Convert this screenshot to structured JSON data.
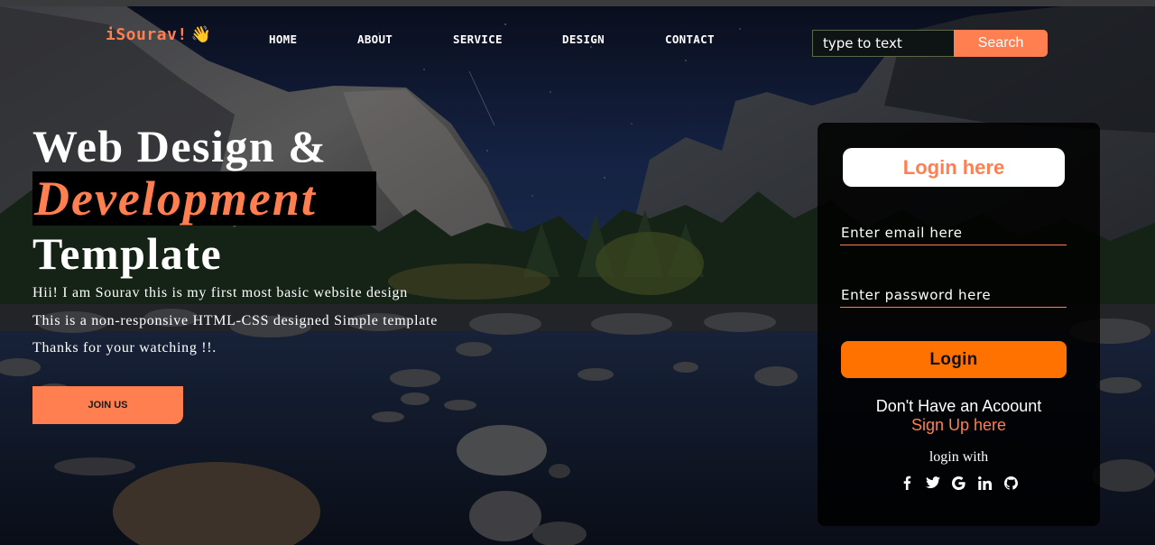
{
  "brand": {
    "name": "iSourav!",
    "emoji": "👋"
  },
  "nav": {
    "items": [
      "HOME",
      "ABOUT",
      "SERVICE",
      "DESIGN",
      "CONTACT"
    ]
  },
  "search": {
    "placeholder": "type to text",
    "button_label": "Search"
  },
  "hero": {
    "line1": "Web Design &",
    "line2": "Development",
    "line3": "Template",
    "paragraphs": [
      "Hii! I am Sourav this is my first most basic website design",
      "This is a non-responsive HTML-CSS designed Simple template",
      "Thanks for your watching !!."
    ],
    "cta_label": "JOIN US"
  },
  "login": {
    "title": "Login here",
    "email_placeholder": "Enter email here",
    "password_placeholder": "Enter password here",
    "submit_label": "Login",
    "no_account_text": "Don't Have an Acoount",
    "signup_label": "Sign Up here",
    "login_with_text": "login with",
    "social_icons": [
      "facebook-icon",
      "twitter-icon",
      "google-icon",
      "linkedin-icon",
      "github-icon"
    ]
  },
  "colors": {
    "accent": "#ff7f50",
    "login_button": "#ff7200",
    "panel_bg": "#000000"
  }
}
